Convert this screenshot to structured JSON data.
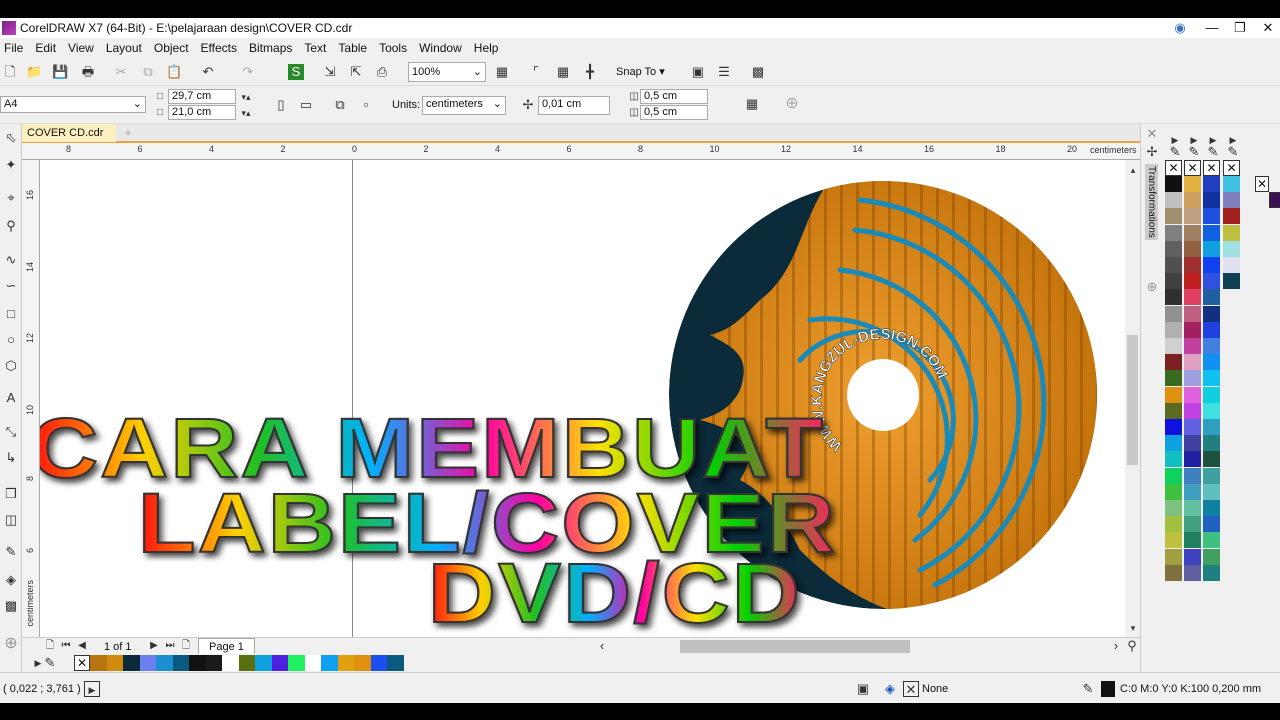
{
  "app": {
    "title": "CorelDRAW X7 (64-Bit) - E:\\pelajaraan design\\COVER CD.cdr"
  },
  "menu": [
    "File",
    "Edit",
    "View",
    "Layout",
    "Object",
    "Effects",
    "Bitmaps",
    "Text",
    "Table",
    "Tools",
    "Window",
    "Help"
  ],
  "toolbar": {
    "zoom": "100%",
    "snap_to": "Snap To"
  },
  "propbar": {
    "page_size": "A4",
    "width": "29,7 cm",
    "height": "21,0 cm",
    "units_label": "Units:",
    "units": "centimeters",
    "nudge": "0,01 cm",
    "dup_x": "0,5 cm",
    "dup_y": "0,5 cm"
  },
  "document_tab": "COVER CD.cdr",
  "ruler": {
    "h_ticks": [
      "8",
      "6",
      "4",
      "2",
      "0",
      "2",
      "4",
      "6",
      "8",
      "10",
      "12",
      "14",
      "16",
      "18",
      "20"
    ],
    "h_unit": "centimeters",
    "v_ticks": [
      "16",
      "14",
      "12",
      "10",
      "8",
      "6"
    ],
    "v_unit": "centimeters"
  },
  "docker": {
    "title": "Transformations"
  },
  "artwork": {
    "lines": [
      "CARA MEMBUAT",
      "LABEL/COVER",
      "DVD/CD"
    ],
    "disc_text": "WWW.KANGZUL-DESIGN.COM",
    "colors": {
      "disc_dark": "#0b2a3a",
      "disc_orange": "#d98a10",
      "arcs": "#1a8ab8"
    }
  },
  "page_nav": {
    "page_count": "1 of 1",
    "page_tab": "Page 1"
  },
  "doc_palette": [
    "#b87410",
    "#d08a10",
    "#0b2a3a",
    "#6a7ff0",
    "#1a90d0",
    "#0a5a80",
    "#111111",
    "#1a1a1a",
    "#ffffff",
    "#5a7010",
    "#10a0e0",
    "#5020e0",
    "#20f060",
    "#ffffff",
    "#10a0f0",
    "#e0a010",
    "#e09010",
    "#1a50f0",
    "#0a5a80"
  ],
  "palette_columns": [
    [
      "#101010",
      "#c0c0c0",
      "#a09070",
      "#808080",
      "#606060",
      "#505050",
      "#404040",
      "#303030",
      "#909090",
      "#b0b0b0",
      "#d0d0d0",
      "#7a2020",
      "#3a6a20",
      "#e09010",
      "#5a6a20",
      "#1010e0",
      "#10a0e0",
      "#10c0c0",
      "#10d060",
      "#40c040",
      "#80c080",
      "#a0c040",
      "#c0c040",
      "#a0a040",
      "#807040"
    ],
    [
      "#e0b040",
      "#d0a060",
      "#c0a080",
      "#a08060",
      "#906040",
      "#a03030",
      "#c02020",
      "#e04060",
      "#c06080",
      "#a02060",
      "#c040a0",
      "#e0a0c0",
      "#a0a0e0",
      "#e060e0",
      "#c040e0",
      "#6060e0",
      "#4040a0",
      "#2020a0",
      "#4080c0",
      "#40a0c0",
      "#60c0a0",
      "#40a080",
      "#208060",
      "#4040c0",
      "#6060a0"
    ],
    [
      "#2040c0",
      "#1030a0",
      "#2050e0",
      "#1060e0",
      "#10a0e0",
      "#1040f0",
      "#3050e0",
      "#2060a0",
      "#103080",
      "#2040e0",
      "#4080e0",
      "#1090f0",
      "#10c0f0",
      "#10d0e0",
      "#40e0e0",
      "#30a0c0",
      "#208080",
      "#205040",
      "#40a0a0",
      "#60c0c0",
      "#1080a0",
      "#2060c0",
      "#40c080",
      "#40a060",
      "#208080"
    ],
    [
      "#40c0e0",
      "#8080c0",
      "#a02020",
      "#c0c040",
      "#a0e0e0",
      "#e0e0f0",
      "#104050",
      "#c04060",
      "#40a0e0",
      "#102040",
      "#4060a0",
      "#6080c0",
      "#a080e0",
      "#103020",
      "#40a060",
      "#804040",
      "#a04040",
      "#c06060",
      "#e08080",
      "#40c0e0",
      "#80e0e0",
      "#a0e0a0",
      "#60c0a0",
      "#40a0c0",
      "#40e0a0"
    ]
  ],
  "status": {
    "coords": "( 0,022 ; 3,761 )",
    "fill": "None",
    "outline": "C:0 M:0 Y:0 K:100  0,200 mm"
  }
}
